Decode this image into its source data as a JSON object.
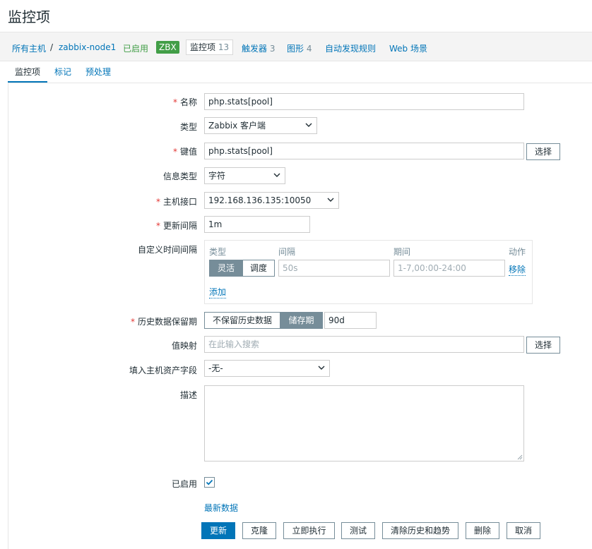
{
  "page": {
    "title": "监控项"
  },
  "breadcrumb": {
    "all_hosts": "所有主机",
    "separator": "/",
    "host": "zabbix-node1",
    "status": "已启用",
    "zbx_badge": "ZBX",
    "items_label": "监控项",
    "items_count": "13",
    "triggers_label": "触发器",
    "triggers_count": "3",
    "graphs_label": "图形",
    "graphs_count": "4",
    "discovery": "自动发现规则",
    "web": "Web 场景"
  },
  "tabs": [
    {
      "label": "监控项",
      "active": true
    },
    {
      "label": "标记",
      "active": false
    },
    {
      "label": "预处理",
      "active": false
    }
  ],
  "form": {
    "name": {
      "label": "名称",
      "value": "php.stats[pool]"
    },
    "type": {
      "label": "类型",
      "value": "Zabbix 客户端"
    },
    "key": {
      "label": "键值",
      "value": "php.stats[pool]",
      "button": "选择"
    },
    "info_type": {
      "label": "信息类型",
      "value": "字符"
    },
    "interface": {
      "label": "主机接口",
      "value": "192.168.136.135:10050"
    },
    "update_interval": {
      "label": "更新间隔",
      "value": "1m"
    },
    "custom_intervals": {
      "label": "自定义时间间隔",
      "headers": {
        "type": "类型",
        "interval": "间隔",
        "period": "期间",
        "action": "动作"
      },
      "row": {
        "flexible": "灵活",
        "scheduling": "调度",
        "interval_placeholder": "50s",
        "period_placeholder": "1-7,00:00-24:00",
        "remove": "移除"
      },
      "add": "添加"
    },
    "history": {
      "label": "历史数据保留期",
      "option_off": "不保留历史数据",
      "option_on": "储存期",
      "value": "90d"
    },
    "valuemap": {
      "label": "值映射",
      "placeholder": "在此输入搜索",
      "button": "选择"
    },
    "inventory": {
      "label": "填入主机资产字段",
      "value": "-无-"
    },
    "description": {
      "label": "描述",
      "value": ""
    },
    "enabled": {
      "label": "已启用",
      "checked": true
    },
    "latest_data": "最新数据"
  },
  "buttons": {
    "update": "更新",
    "clone": "克隆",
    "execute": "立即执行",
    "test": "测试",
    "clear": "清除历史和趋势",
    "delete": "删除",
    "cancel": "取消"
  },
  "colors": {
    "link": "#0275b8",
    "enabled_green": "#429e47",
    "required_red": "#e33734",
    "primary_button": "#0275b8",
    "toggle_active": "#768d99"
  }
}
